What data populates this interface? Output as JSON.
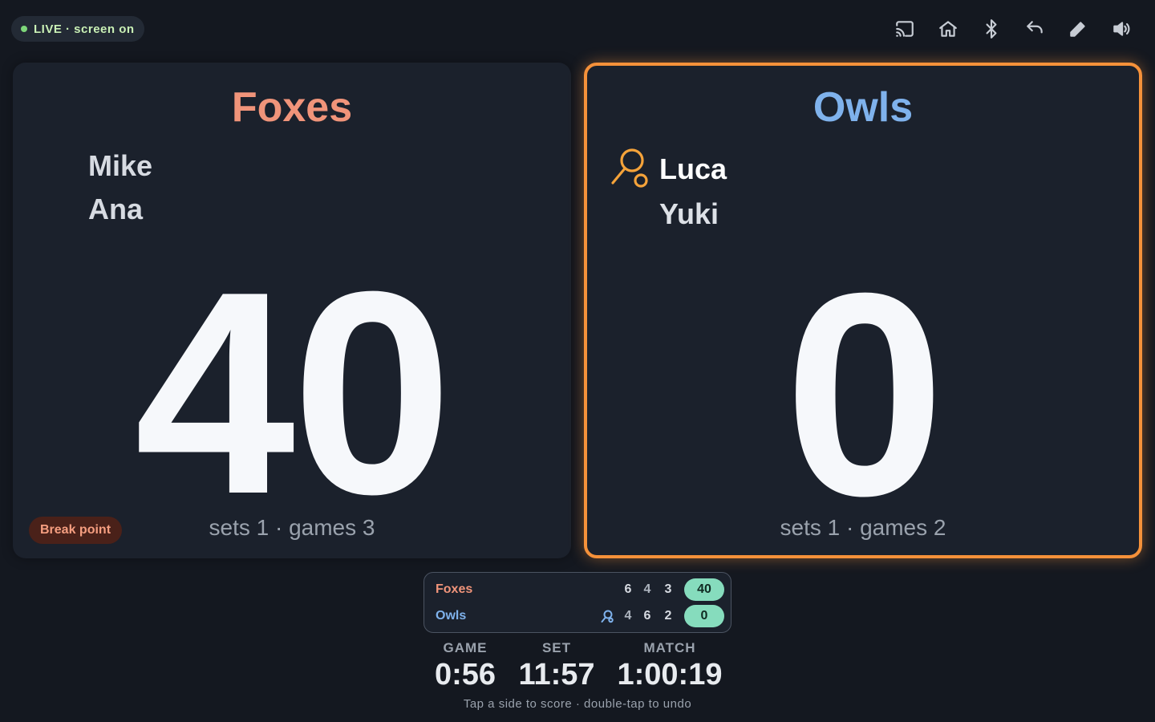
{
  "status": {
    "label": "LIVE · screen on",
    "dot_color": "#7ed67a"
  },
  "toolbar": {
    "icons": [
      "cast-icon",
      "home-icon",
      "bluetooth-icon",
      "undo-icon",
      "edit-icon",
      "volume-icon"
    ]
  },
  "left_team": {
    "name": "Foxes",
    "color": "#f0947a",
    "players": [
      "Mike",
      "Ana"
    ],
    "score": "40",
    "sets_games": "sets 1 · games 3",
    "badge": "Break point"
  },
  "right_team": {
    "name": "Owls",
    "color": "#7fb2ec",
    "serving": true,
    "players": [
      "Luca",
      "Yuki"
    ],
    "score": "0",
    "sets_games": "sets 1 · games 2",
    "highlight_color": "#f5913a"
  },
  "mini_board": {
    "rows": [
      {
        "team": "Foxes",
        "sets": [
          "6",
          "4",
          "3"
        ],
        "points": "40"
      },
      {
        "team": "Owls",
        "sets": [
          "4",
          "6",
          "2"
        ],
        "points": "0"
      }
    ],
    "points_color": "#86dcbd"
  },
  "timers": {
    "game": {
      "label": "GAME",
      "value": "0:56"
    },
    "set": {
      "label": "SET",
      "value": "11:57"
    },
    "match": {
      "label": "MATCH",
      "value": "1:00:19"
    }
  },
  "hint": "Tap a side to score · double-tap to undo"
}
